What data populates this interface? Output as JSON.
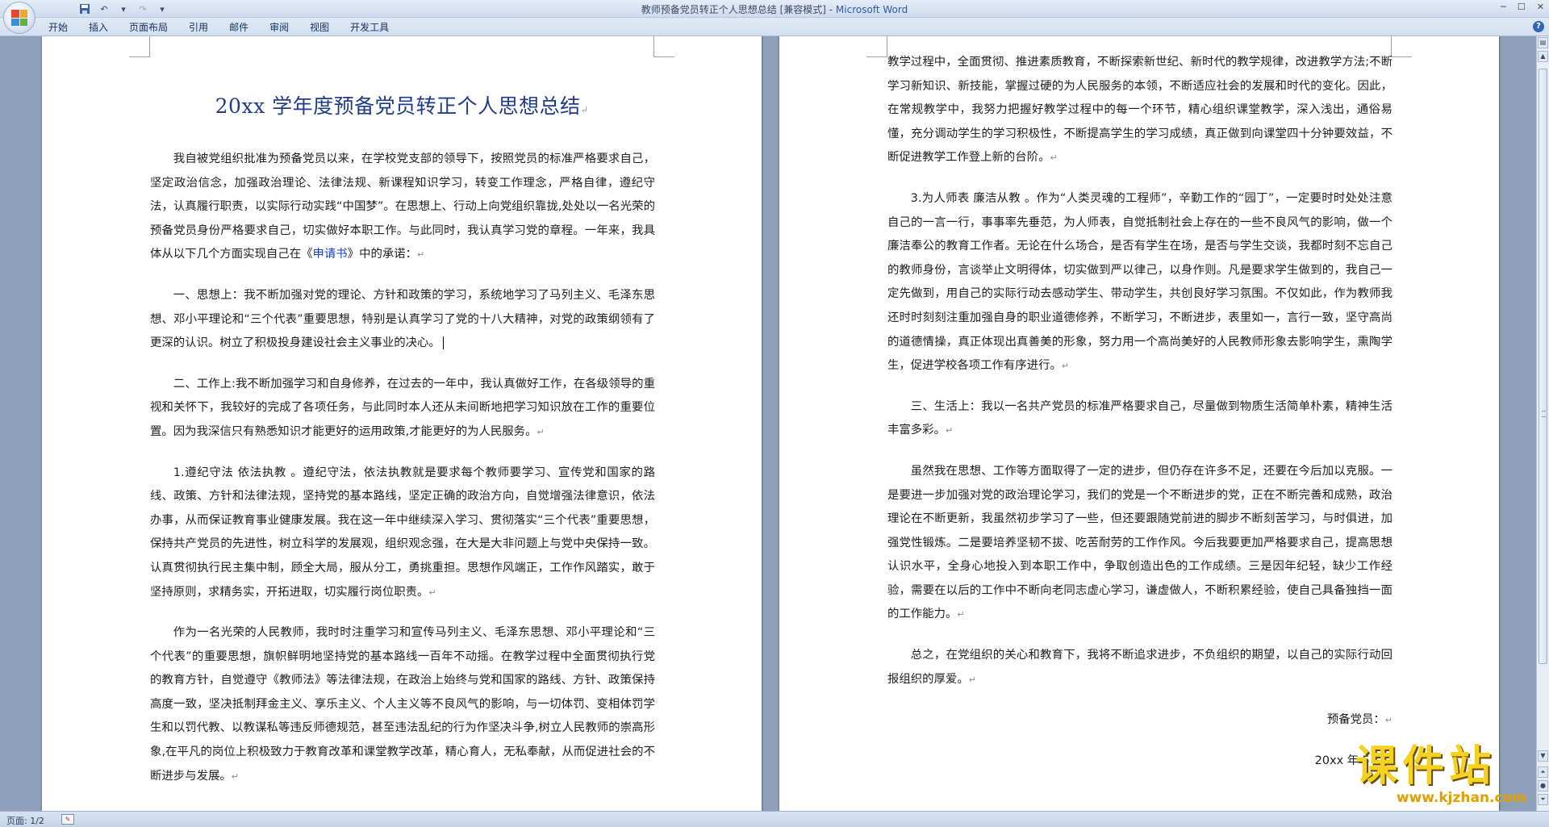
{
  "window": {
    "title": "教师预备党员转正个人思想总结 [兼容模式] - ",
    "app_name": "Microsoft Word"
  },
  "ribbon": {
    "tabs": [
      "开始",
      "插入",
      "页面布局",
      "引用",
      "邮件",
      "审阅",
      "视图",
      "开发工具"
    ]
  },
  "document": {
    "title": "20xx 学年度预备党员转正个人思想总结",
    "left_page": {
      "p1_a": "我自被党组织批准为预备党员以来，在学校党支部的领导下，按照党员的标准严格要求自己，坚定政治信念，加强政治理论、法律法规、新课程知识学习，转变工作理念，严格自律，遵纪守法，认真履行职责，以实际行动实践“中国梦”。在思想上、行动上向党组织靠拢,处处以一名光荣的预备党员身份严格要求自己，切实做好本职工作。与此同时，我认真学习党的章程。一年来，我具体从以下几个方面实现自己在《",
      "p1_link": "申请书",
      "p1_b": "》中的承诺：",
      "p2": "一、思想上：我不断加强对党的理论、方针和政策的学习，系统地学习了马列主义、毛泽东思想、邓小平理论和“三个代表”重要思想，特别是认真学习了党的十八大精神，对党的政策纲领有了更深的认识。树立了积极投身建设社会主义事业的决心。",
      "p3": "二、工作上:我不断加强学习和自身修养，在过去的一年中，我认真做好工作，在各级领导的重视和关怀下，我较好的完成了各项任务，与此同时本人还从未间断地把学习知识放在工作的重要位置。因为我深信只有熟悉知识才能更好的运用政策,才能更好的为人民服务。",
      "p4": "1.遵纪守法  依法执教 。遵纪守法，依法执教就是要求每个教师要学习、宣传党和国家的路线、政策、方针和法律法规，坚持党的基本路线，坚定正确的政治方向，自觉增强法律意识，依法办事，从而保证教育事业健康发展。我在这一年中继续深入学习、贯彻落实“三个代表”重要思想，保持共产党员的先进性，树立科学的发展观，组织观念强，在大是大非问题上与党中央保持一致。认真贯彻执行民主集中制，顾全大局，服从分工，勇挑重担。思想作风端正，工作作风踏实，敢于坚持原则，求精务实，开拓进取，切实履行岗位职责。",
      "p5": "作为一名光荣的人民教师，我时时注重学习和宣传马列主义、毛泽东思想、邓小平理论和“三个代表”的重要思想，旗帜鲜明地坚持党的基本路线一百年不动摇。在教学过程中全面贯彻执行党的教育方针，自觉遵守《教师法》等法律法规，在政治上始终与党和国家的路线、方针、政策保持高度一致，坚决抵制拜金主义、享乐主义、个人主义等不良风气的影响，与一切体罚、变相体罚学生和以罚代教、以教谋私等违反师德规范，甚至违法乱纪的行为作坚决斗争,树立人民教师的崇高形象,在平凡的岗位上积极致力于教育改革和课堂教学改革，精心育人，无私奉献，从而促进社会的不断进步与发展。"
    },
    "right_page": {
      "p1": "教学过程中，全面贯彻、推进素质教育，不断探索新世纪、新时代的教学规律，改进教学方法;不断学习新知识、新技能，掌握过硬的为人民服务的本领，不断适应社会的发展和时代的变化。因此，在常规教学中，我努力把握好教学过程中的每一个环节，精心组织课堂教学，深入浅出，通俗易懂，充分调动学生的学习积极性，不断提高学生的学习成绩，真正做到向课堂四十分钟要效益，不断促进教学工作登上新的台阶。",
      "p2": "3.为人师表  廉洁从教 。作为“人类灵魂的工程师”，辛勤工作的“园丁”，一定要时时处处注意自己的一言一行，事事率先垂范，为人师表，自觉抵制社会上存在的一些不良风气的影响，做一个廉洁奉公的教育工作者。无论在什么场合，是否有学生在场，是否与学生交谈，我都时刻不忘自己的教师身份，言谈举止文明得体，切实做到严以律己，以身作则。凡是要求学生做到的，我自己一定先做到，用自己的实际行动去感动学生、带动学生，共创良好学习氛围。不仅如此，作为教师我还时时刻刻注重加强自身的职业道德修养，不断学习，不断进步，表里如一，言行一致，坚守高尚的道德情操，真正体现出真善美的形象，努力用一个高尚美好的人民教师形象去影响学生，熏陶学生，促进学校各项工作有序进行。",
      "p3": "三、生活上：我以一名共产党员的标准严格要求自己，尽量做到物质生活简单朴素，精神生活丰富多彩。",
      "p4": "虽然我在思想、工作等方面取得了一定的进步，但仍存在许多不足，还要在今后加以克服。一是要进一步加强对党的政治理论学习，我们的党是一个不断进步的党，正在不断完善和成熟，政治理论在不断更新，我虽然初步学习了一些，但还要跟随党前进的脚步不断刻苦学习，与时俱进，加强党性锻炼。二是要培养坚韧不拔、吃苦耐劳的工作作风。今后我要更加严格要求自己，提高思想认识水平，全身心地投入到本职工作中，争取创造出色的工作成绩。三是因年纪轻，缺少工作经验，需要在以后的工作中不断向老同志虚心学习，谦虚做人，不断积累经验，使自己具备独挡一面的工作能力。",
      "p5": "总之，在党组织的关心和教育下，我将不断追求进步，不负组织的期望，以自己的实际行动回报组织的厚爱。",
      "signature": "预备党员：",
      "date": "20xx 年 5 月"
    }
  },
  "paragraph_mark": "↵",
  "status": {
    "page": "页面: 1/2"
  },
  "watermark": {
    "main": "课件站",
    "url": "www.kjzhan.com"
  },
  "colors": {
    "title_blue": "#1f3c88",
    "link_blue": "#1a3fcc",
    "watermark_yellow": "#f4d21f"
  }
}
